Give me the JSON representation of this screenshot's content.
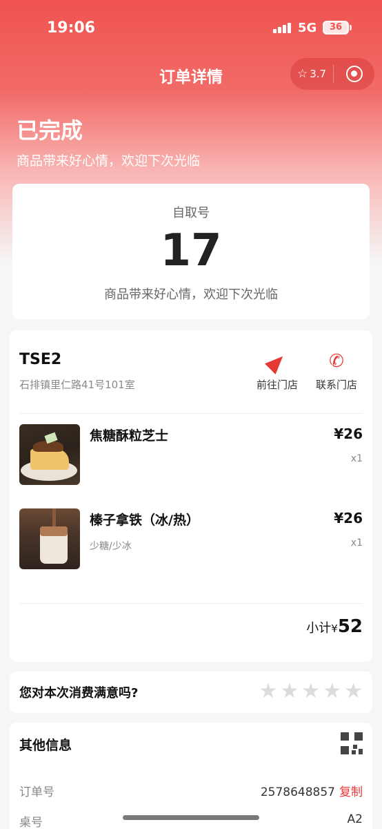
{
  "status_bar": {
    "time": "19:06",
    "network": "5G",
    "battery": "36"
  },
  "nav": {
    "title": "订单详情",
    "rating": "3.7"
  },
  "order": {
    "status": "已完成",
    "subtitle": "商品带来好心情，欢迎下次光临"
  },
  "pickup": {
    "label": "自取号",
    "number": "17",
    "message": "商品带来好心情，欢迎下次光临"
  },
  "store": {
    "name": "TSE2",
    "address": "石排镇里仁路41号101室",
    "navigate_label": "前往门店",
    "contact_label": "联系门店"
  },
  "items": [
    {
      "name": "焦糖酥粒芝士",
      "spec": "",
      "price": "¥26",
      "qty": "x1"
    },
    {
      "name": "榛子拿铁（冰/热）",
      "spec": "少糖/少冰",
      "price": "¥26",
      "qty": "x1"
    }
  ],
  "subtotal": {
    "label": "小计",
    "currency": "¥",
    "amount": "52"
  },
  "rating_prompt": {
    "question": "您对本次消费满意吗?",
    "stars": 5
  },
  "other_info": {
    "title": "其他信息",
    "rows": [
      {
        "key": "订单号",
        "value": "2578648857",
        "action": "复制"
      },
      {
        "key": "桌号",
        "value": "A2"
      }
    ]
  },
  "colors": {
    "accent": "#e53935",
    "header": "#ef5350"
  }
}
